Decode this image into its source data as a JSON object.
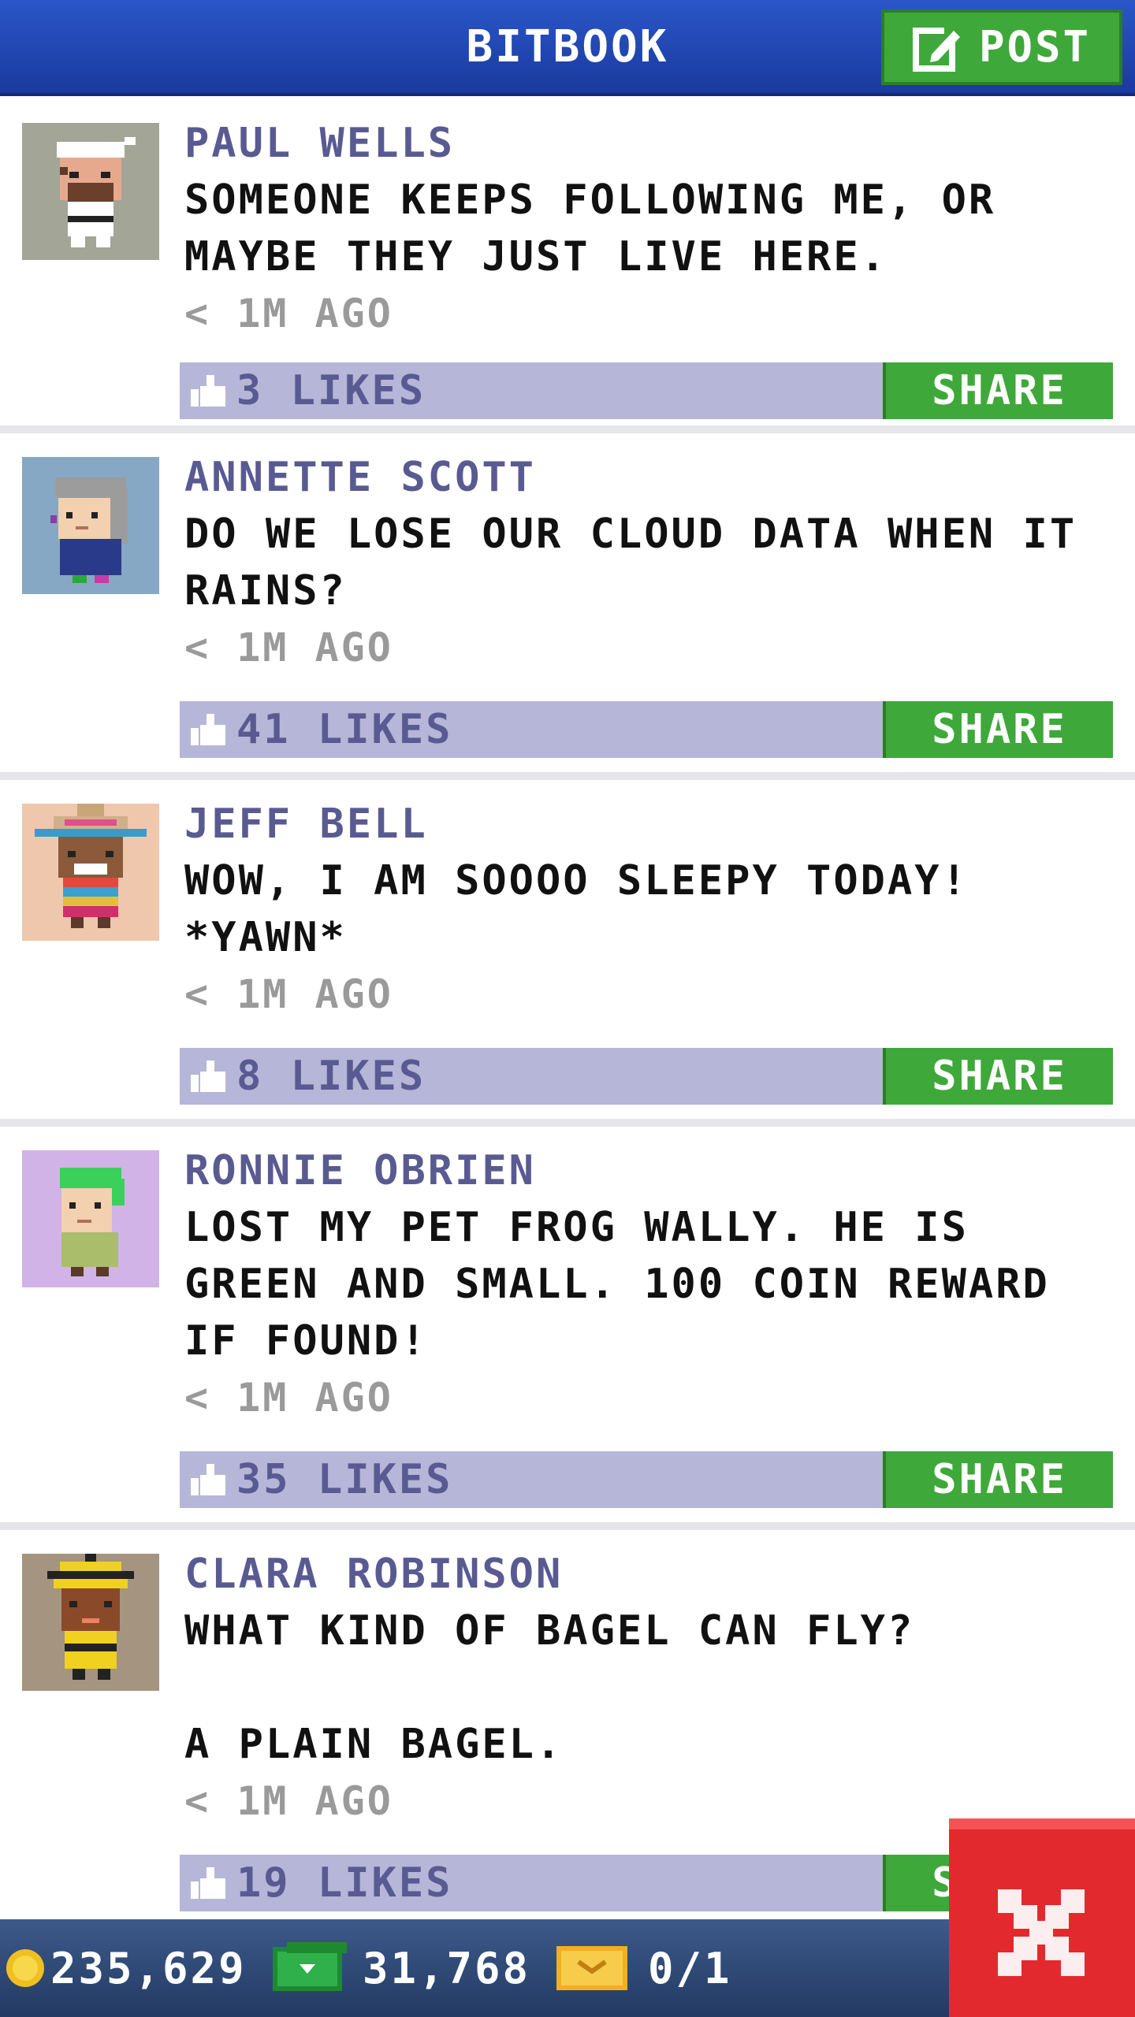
{
  "header": {
    "title": "BITBOOK",
    "post_label": "POST"
  },
  "colors": {
    "accent_blue": "#2a56c8",
    "share_green": "#3fa83a",
    "likes_bar": "#b5b6d8",
    "name_purple": "#5a5a92",
    "close_red": "#e22a2e"
  },
  "posts": [
    {
      "name": "PAUL WELLS",
      "message": "SOMEONE KEEPS FOLLOWING ME, OR\nMAYBE THEY JUST LIVE HERE.",
      "time": "< 1M AGO",
      "likes": "3 LIKES",
      "share": "SHARE",
      "avatar_icon": "karate-man-avatar"
    },
    {
      "name": "ANNETTE SCOTT",
      "message": "DO WE LOSE OUR CLOUD DATA WHEN IT\nRAINS?",
      "time": "< 1M AGO",
      "likes": "41 LIKES",
      "share": "SHARE",
      "avatar_icon": "gray-haired-woman-avatar"
    },
    {
      "name": "JEFF BELL",
      "message": "WOW, I AM SOOOO SLEEPY TODAY!\n*YAWN*",
      "time": "< 1M AGO",
      "likes": "8 LIKES",
      "share": "SHARE",
      "avatar_icon": "sombrero-man-avatar"
    },
    {
      "name": "RONNIE OBRIEN",
      "message": "LOST MY PET FROG WALLY. HE IS\nGREEN AND SMALL. 100 COIN REWARD\nIF FOUND!",
      "time": "< 1M AGO",
      "likes": "35 LIKES",
      "share": "SHARE",
      "avatar_icon": "green-haired-avatar"
    },
    {
      "name": "CLARA ROBINSON",
      "message": "WHAT KIND OF BAGEL CAN FLY?\n\nA PLAIN BAGEL.",
      "time": "< 1M AGO",
      "likes": "19 LIKES",
      "share": "SHARE",
      "avatar_icon": "yellow-hat-avatar"
    }
  ],
  "footer": {
    "coins": "235,629",
    "bux": "31,768",
    "tickets": "0/1"
  }
}
